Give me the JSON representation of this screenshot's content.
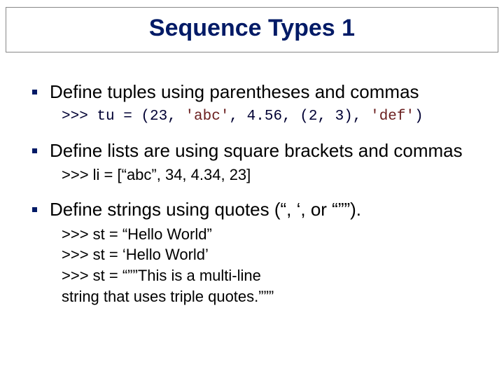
{
  "title": "Sequence Types 1",
  "bullets": {
    "b1": {
      "text": "Define tuples using parentheses and commas",
      "code": {
        "prefix": ">>> tu = (23, ",
        "s1": "'abc'",
        "mid1": ", 4.56, (2, 3), ",
        "s2": "'def'",
        "suffix": ")"
      }
    },
    "b2": {
      "text": "Define lists are using square brackets and commas",
      "sub": ">>> li = [“abc”, 34, 4.34, 23]"
    },
    "b3": {
      "text": "Define strings using quotes (“, ‘, or “””).",
      "lines": {
        "l1": ">>> st = “Hello World”",
        "l2": ">>> st = ‘Hello World’",
        "l3": ">>> st = “””This is a multi-line",
        "l4": "string that uses triple quotes.”””"
      }
    }
  }
}
